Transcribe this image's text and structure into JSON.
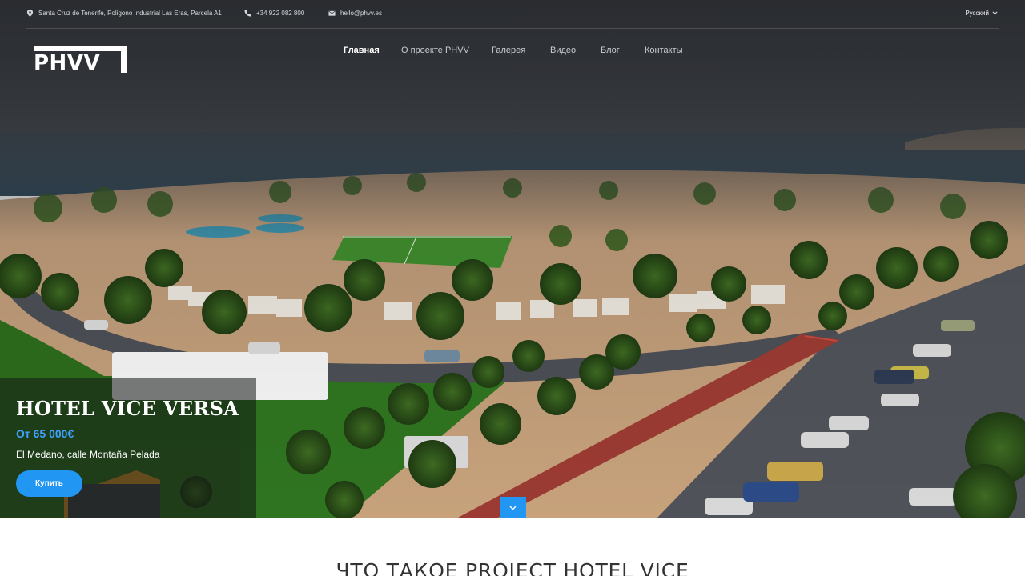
{
  "topbar": {
    "address": "Santa Cruz de Tenerife, Poligono Industrial Las Eras, Parcela A1",
    "phone": "+34 922 082 800",
    "email": "hello@phvv.es",
    "language": "Русский",
    "icons": {
      "address": "map-marker-icon",
      "phone": "phone-icon",
      "email": "envelope-icon",
      "language": "chevron-down-icon"
    }
  },
  "logo": {
    "text": "PHVV"
  },
  "nav": {
    "items": [
      {
        "label": "Главная",
        "active": true
      },
      {
        "label": "О проекте PHVV",
        "active": false
      },
      {
        "label": "Галерея",
        "active": false
      },
      {
        "label": "Видео",
        "active": false
      },
      {
        "label": "Блог",
        "active": false
      },
      {
        "label": "Контакты",
        "active": false
      }
    ]
  },
  "hero": {
    "title": "HOTEL VICE VERSA",
    "price": "От 65 000€",
    "address": "El Medano, calle Montaña Pelada",
    "button": "Купить",
    "scroll_icon": "chevron-down-icon"
  },
  "section": {
    "title": "ЧТО ТАКОЕ PROJECT HOTEL VICE"
  },
  "colors": {
    "accent": "#2196f3",
    "price": "#3fa3ff",
    "topbar_text": "#d6d8db"
  }
}
